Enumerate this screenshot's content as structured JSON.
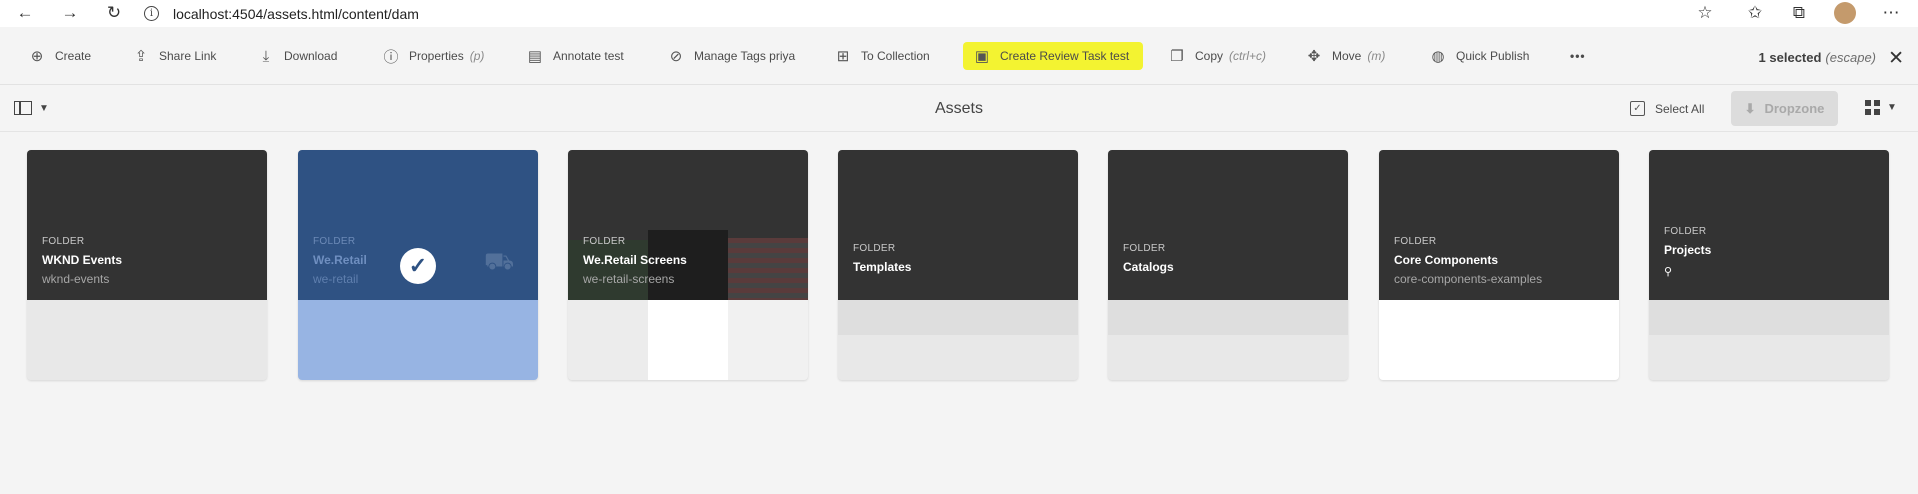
{
  "browser": {
    "url": "localhost:4504/assets.html/content/dam",
    "info_glyph": "i"
  },
  "actionbar": {
    "actions": [
      {
        "label": "Create",
        "icon": "plus-circle-icon"
      },
      {
        "label": "Share Link",
        "icon": "share-icon"
      },
      {
        "label": "Download",
        "icon": "download-icon"
      },
      {
        "label": "Properties",
        "shortcut": "(p)",
        "icon": "info-icon"
      },
      {
        "label": "Annotate test",
        "icon": "annotate-icon"
      },
      {
        "label": "Manage Tags priya",
        "icon": "tag-icon"
      },
      {
        "label": "To Collection",
        "icon": "collection-icon"
      },
      {
        "label": "Create Review Task test",
        "icon": "review-task-icon"
      },
      {
        "label": "Copy",
        "shortcut": "(ctrl+c)",
        "icon": "copy-icon"
      },
      {
        "label": "Move",
        "shortcut": "(m)",
        "icon": "move-icon"
      },
      {
        "label": "Quick Publish",
        "icon": "globe-icon"
      }
    ],
    "more": "•••",
    "selection": {
      "count": "1 selected",
      "hint": "(escape)"
    },
    "highlight_color": "#f3f331"
  },
  "titlebar": {
    "title": "Assets",
    "select_all": "Select All",
    "dropzone": "Dropzone"
  },
  "cards": [
    {
      "type": "FOLDER",
      "name": "WKND Events",
      "sub": "wknd-events",
      "selected": false
    },
    {
      "type": "FOLDER",
      "name": "We.Retail",
      "sub": "we-retail",
      "selected": true
    },
    {
      "type": "FOLDER",
      "name": "We.Retail Screens",
      "sub": "we-retail-screens",
      "selected": false
    },
    {
      "type": "FOLDER",
      "name": "Templates",
      "sub": "",
      "selected": false
    },
    {
      "type": "FOLDER",
      "name": "Catalogs",
      "sub": "",
      "selected": false
    },
    {
      "type": "FOLDER",
      "name": "Core Components",
      "sub": "core-components-examples",
      "selected": false
    },
    {
      "type": "FOLDER",
      "name": "Projects",
      "sub": "",
      "selected": false
    }
  ],
  "colors": {
    "selected_thumb": "#2f5283",
    "selected_bottom": "#97b4e3",
    "card_thumb": "#333333"
  }
}
